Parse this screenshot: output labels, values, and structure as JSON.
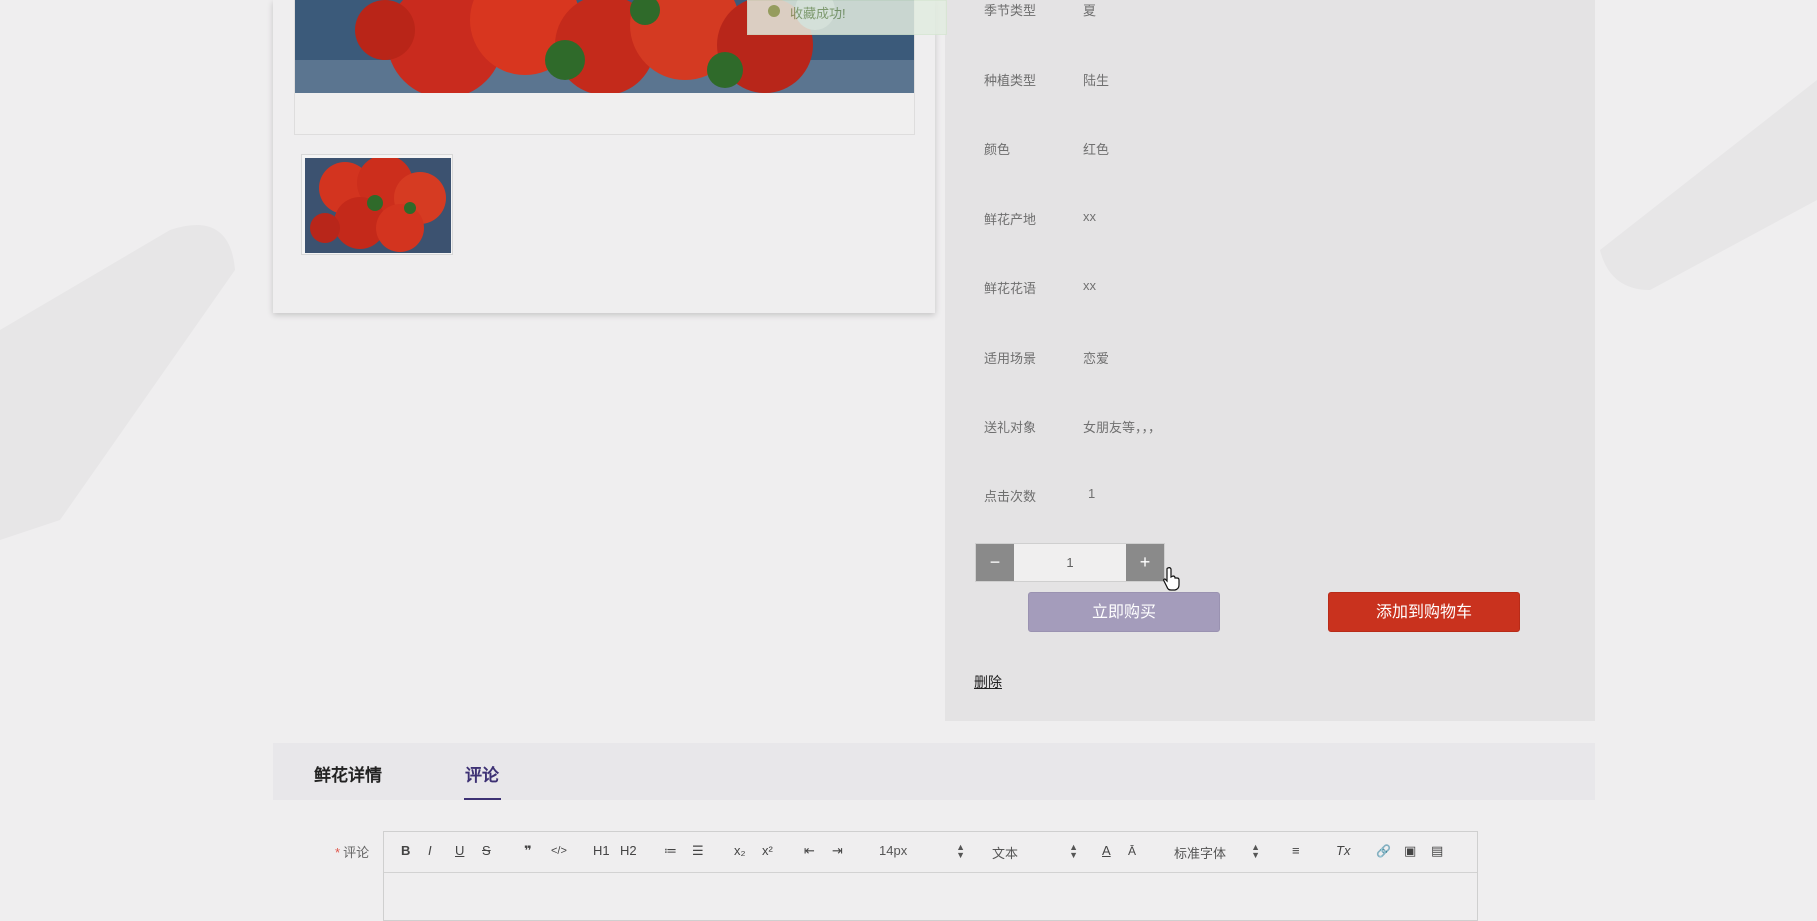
{
  "toast": {
    "message": "收藏成功!"
  },
  "attributes": [
    {
      "label": "季节类型",
      "value": "夏"
    },
    {
      "label": "种植类型",
      "value": "陆生"
    },
    {
      "label": "颜色",
      "value": "红色"
    },
    {
      "label": "鲜花产地",
      "value": "xx"
    },
    {
      "label": "鲜花花语",
      "value": "xx"
    },
    {
      "label": "适用场景",
      "value": "恋爱"
    },
    {
      "label": "送礼对象",
      "value": "女朋友等，，，"
    },
    {
      "label": "点击次数",
      "value": "1"
    }
  ],
  "quantity": {
    "minus": "−",
    "value": "1",
    "plus": "+"
  },
  "actions": {
    "buy_now": "立即购买",
    "add_to_cart": "添加到购物车",
    "delete": "删除"
  },
  "tabs": [
    {
      "label": "鲜花详情",
      "active": false
    },
    {
      "label": "评论",
      "active": true
    }
  ],
  "comment": {
    "required_mark": "*",
    "label": "评论",
    "toolbar": {
      "bold": "B",
      "italic": "I",
      "underline": "U",
      "strike": "S",
      "quote": "❞",
      "code": "</>",
      "h1": "H1",
      "h2": "H2",
      "ordered_list": "≔",
      "bullet_list": "☰",
      "subscript": "x₂",
      "superscript": "x²",
      "outdent": "⇤",
      "indent": "⇥",
      "font_size": "14px",
      "header": "文本",
      "font_color": "A",
      "background": "Ā",
      "font_family": "标准字体",
      "align": "≡",
      "clean": "Tx",
      "link": "🔗",
      "image": "▣",
      "video": "▤"
    }
  },
  "colors": {
    "accent": "#3d3174",
    "cart": "#c9321e",
    "buy": "#a49cbb"
  }
}
